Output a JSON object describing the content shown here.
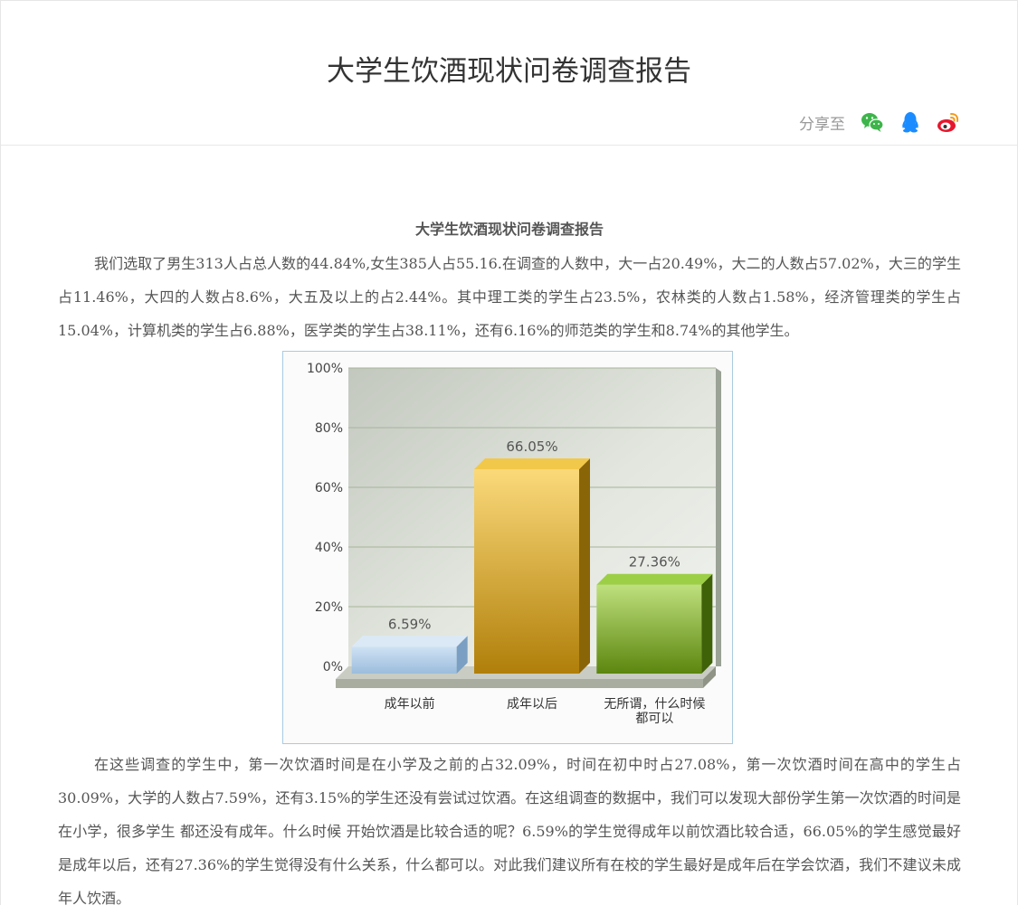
{
  "header": {
    "title": "大学生饮酒现状问卷调查报告",
    "share_label": "分享至",
    "share_icons": [
      "wechat-icon",
      "qq-icon",
      "weibo-icon"
    ],
    "icon_colors": {
      "wechat": "#3db54a",
      "qq": "#1a8cff",
      "weibo": "#e6162d"
    }
  },
  "article": {
    "title": "大学生饮酒现状问卷调查报告",
    "paragraph1": "我们选取了男生313人占总人数的44.84%,女生385人占55.16.在调查的人数中，大一占20.49%，大二的人数占57.02%，大三的学生占11.46%，大四的人数占8.6%，大五及以上的占2.44%。其中理工类的学生占23.5%，农林类的人数占1.58%，经济管理类的学生占15.04%，计算机类的学生占6.88%，医学类的学生占38.11%，还有6.16%的师范类的学生和8.74%的其他学生。",
    "paragraph2": "在这些调查的学生中，第一次饮酒时间是在小学及之前的占32.09%，时间在初中时占27.08%，第一次饮酒时间在高中的学生占30.09%，大学的人数占7.59%，还有3.15%的学生还没有尝试过饮酒。在这组调查的数据中，我们可以发现大部份学生第一次饮酒的时间是在小学，很多学生 都还没有成年。什么时候 开始饮酒是比较合适的呢？6.59%的学生觉得成年以前饮酒比较合适，66.05%的学生感觉最好是成年以后，还有27.36%的学生觉得没有什么关系，什么都可以。对此我们建议所有在校的学生最好是成年后在学会饮酒，我们不建议未成年人饮酒。"
  },
  "chart_data": {
    "type": "bar",
    "categories": [
      "成年以前",
      "成年以后",
      "无所谓，什么时候都可以"
    ],
    "category_lines": [
      [
        "成年以前"
      ],
      [
        "成年以后"
      ],
      [
        "无所谓，什么时候",
        "都可以"
      ]
    ],
    "values": [
      6.59,
      66.05,
      27.36
    ],
    "value_labels": [
      "6.59%",
      "66.05%",
      "27.36%"
    ],
    "yticks": [
      "0%",
      "20%",
      "40%",
      "60%",
      "80%",
      "100%"
    ],
    "ylim": [
      0,
      100
    ],
    "grid": true,
    "bar_colors": [
      {
        "light": "#c5dcf0",
        "dark": "#90b5d6",
        "side": "#7a9fc2",
        "top": "#dbe9f7"
      },
      {
        "light": "#fcd978",
        "dark": "#b8860b",
        "side": "#8a6508",
        "top": "#f2c84a"
      },
      {
        "light": "#bde07c",
        "dark": "#5e8a0e",
        "side": "#3f6108",
        "top": "#9ccf46"
      }
    ]
  }
}
